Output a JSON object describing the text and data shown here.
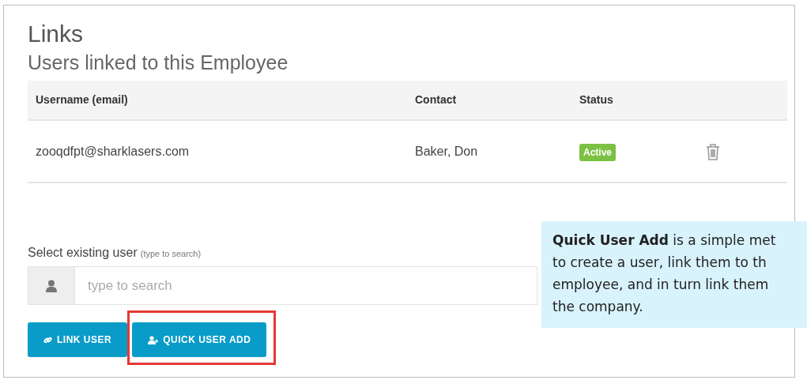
{
  "title": "Links",
  "subtitle": "Users linked to this Employee",
  "table": {
    "columns": [
      "Username (email)",
      "Contact",
      "Status"
    ],
    "rows": [
      {
        "username": "zooqdfpt@sharklasers.com",
        "contact": "Baker, Don",
        "status": "Active"
      }
    ]
  },
  "select_user": {
    "label": "Select existing user",
    "hint": "(type to search)",
    "placeholder": "type to search"
  },
  "buttons": [
    {
      "label": "LINK USER",
      "kind": "link",
      "highlighted": false
    },
    {
      "label": "QUICK USER ADD",
      "kind": "add-user",
      "highlighted": true
    }
  ],
  "callout": {
    "lines": [
      "**Quick User Add** is a simple met",
      "to create a user, link them to th",
      "employee, and in turn link them",
      "the company."
    ]
  }
}
